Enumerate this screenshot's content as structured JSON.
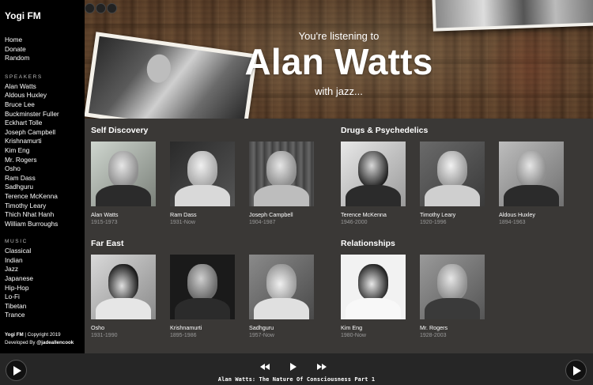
{
  "sidebar": {
    "brand": "Yogi FM",
    "nav": [
      "Home",
      "Donate",
      "Random"
    ],
    "speakers_label": "SPEAKERS",
    "speakers": [
      "Alan Watts",
      "Aldous Huxley",
      "Bruce Lee",
      "Buckminster Fuller",
      "Eckhart Tolle",
      "Joseph Campbell",
      "Krishnamurti",
      "Kim Eng",
      "Mr. Rogers",
      "Osho",
      "Ram Dass",
      "Sadhguru",
      "Terence McKenna",
      "Timothy Leary",
      "Thich Nhat Hanh",
      "William Burroughs"
    ],
    "music_label": "MUSIC",
    "music": [
      "Classical",
      "Indian",
      "Jazz",
      "Japanese",
      "Hip-Hop",
      "Lo-Fi",
      "Tibetan",
      "Trance"
    ],
    "footer_brand": "Yogi FM",
    "footer_copy": " | Copyright 2019",
    "footer_dev_prefix": "Developed By ",
    "footer_dev": "@jadeallencook"
  },
  "hero": {
    "subtitle": "You're listening to",
    "title": "Alan Watts",
    "tagline": "with jazz..."
  },
  "groups": [
    {
      "title": "Self Discovery",
      "cards": [
        {
          "name": "Alan Watts",
          "years": "1915-1973"
        },
        {
          "name": "Ram Dass",
          "years": "1931-Now"
        },
        {
          "name": "Joseph Campbell",
          "years": "1904-1987"
        }
      ]
    },
    {
      "title": "Drugs & Psychedelics",
      "cards": [
        {
          "name": "Terence McKenna",
          "years": "1946-2000"
        },
        {
          "name": "Timothy Leary",
          "years": "1920-1996"
        },
        {
          "name": "Aldous Huxley",
          "years": "1894-1963"
        }
      ]
    },
    {
      "title": "Far East",
      "cards": [
        {
          "name": "Osho",
          "years": "1931-1990"
        },
        {
          "name": "Krishnamurti",
          "years": "1895-1986"
        },
        {
          "name": "Sadhguru",
          "years": "1957-Now"
        }
      ]
    },
    {
      "title": "Relationships",
      "cards": [
        {
          "name": "Kim Eng",
          "years": "1980-Now"
        },
        {
          "name": "Mr. Rogers",
          "years": "1928-2003"
        }
      ]
    }
  ],
  "player": {
    "speaker": "Alan Watts",
    "track": ": The Nature Of Consciousness Part 1",
    "icons": [
      "play-icon",
      "rewind-icon",
      "fast-forward-icon"
    ]
  }
}
